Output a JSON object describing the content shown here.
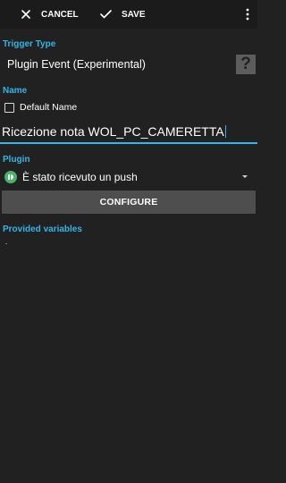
{
  "toolbar": {
    "cancel_label": "CANCEL",
    "save_label": "SAVE",
    "cancel_icon": "close-icon",
    "save_icon": "check-icon",
    "overflow_icon": "more-vertical-icon"
  },
  "trigger_type": {
    "label": "Trigger Type",
    "value": "Plugin Event (Experimental)",
    "help_label": "?"
  },
  "name_section": {
    "label": "Name",
    "default_name_label": "Default Name",
    "default_name_checked": false,
    "input_value": "Ricezione nota WOL_PC_CAMERETTA"
  },
  "plugin_section": {
    "label": "Plugin",
    "selected": "È stato ricevuto un push",
    "icon": "pushbullet-icon",
    "configure_label": "CONFIGURE"
  },
  "provided_variables": {
    "label": "Provided variables"
  },
  "colors": {
    "background": "#212121",
    "toolbar": "#1b1b1b",
    "accent": "#33b5e5",
    "button": "#4e4e4e",
    "plugin_icon": "#4ab367"
  }
}
